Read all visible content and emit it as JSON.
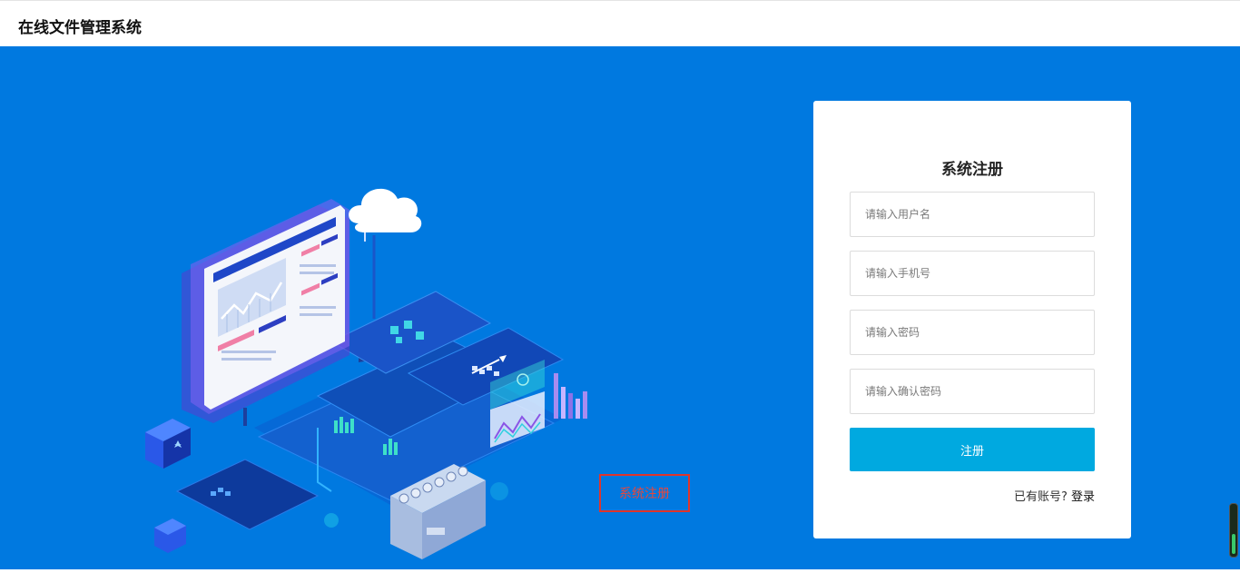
{
  "header": {
    "title": "在线文件管理系统"
  },
  "annotation": {
    "label": "系统注册"
  },
  "register_card": {
    "title": "系统注册",
    "fields": [
      {
        "placeholder": "请输入用户名"
      },
      {
        "placeholder": "请输入手机号"
      },
      {
        "placeholder": "请输入密码"
      },
      {
        "placeholder": "请输入确认密码"
      }
    ],
    "submit_label": "注册",
    "have_account_text": "已有账号?",
    "login_link": "登录"
  },
  "colors": {
    "background": "#0079e0",
    "submit_button": "#00a9e0",
    "annotation_border": "#e0352b"
  },
  "icons": [
    "cloud-icon",
    "isometric-dashboard-illustration"
  ]
}
